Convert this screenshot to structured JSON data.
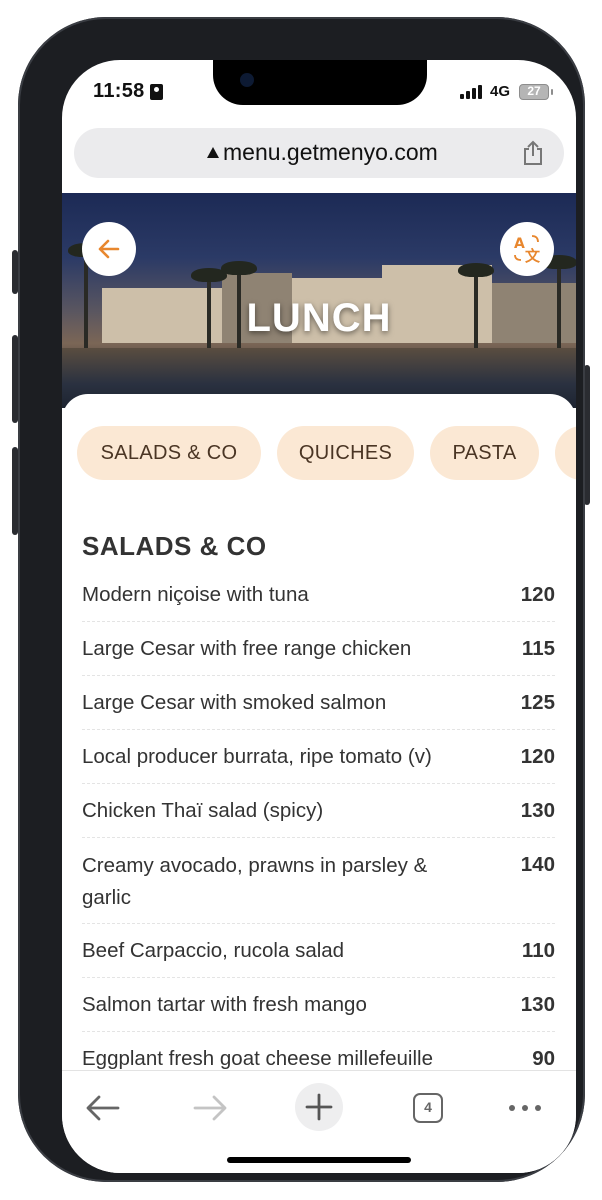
{
  "status_bar": {
    "time": "11:58",
    "network": "4G",
    "battery": "27"
  },
  "browser": {
    "url": "menu.getmenyo.com",
    "open_tabs": "4"
  },
  "hero": {
    "title": "LUNCH"
  },
  "category_tabs": [
    {
      "label": "SALADS & CO",
      "active": true
    },
    {
      "label": "QUICHES",
      "active": false
    },
    {
      "label": "PASTA",
      "active": false
    }
  ],
  "section": {
    "title": "SALADS & CO",
    "items": [
      {
        "name": "Modern niçoise with tuna",
        "price": "120"
      },
      {
        "name": "Large Cesar with free range chicken",
        "price": "115"
      },
      {
        "name": "Large Cesar with smoked salmon",
        "price": "125"
      },
      {
        "name": "Local producer burrata, ripe tomato (v)",
        "price": "120"
      },
      {
        "name": "Chicken Thaï salad (spicy)",
        "price": "130"
      },
      {
        "name": "Creamy avocado, prawns in parsley & garlic",
        "price": "140"
      },
      {
        "name": "Beef Carpaccio, rucola salad",
        "price": "110"
      },
      {
        "name": "Salmon tartar with fresh mango",
        "price": "130"
      },
      {
        "name": "Eggplant fresh goat cheese millefeuille",
        "price": "90"
      }
    ]
  },
  "colors": {
    "accent": "#e8872e",
    "tab_bg": "#fbe8d4",
    "tab_text": "#4a3524",
    "text": "#333333"
  },
  "icons": {
    "back": "arrow-left-icon",
    "translate": "translate-icon",
    "share": "share-icon",
    "lock": "lock-icon"
  }
}
